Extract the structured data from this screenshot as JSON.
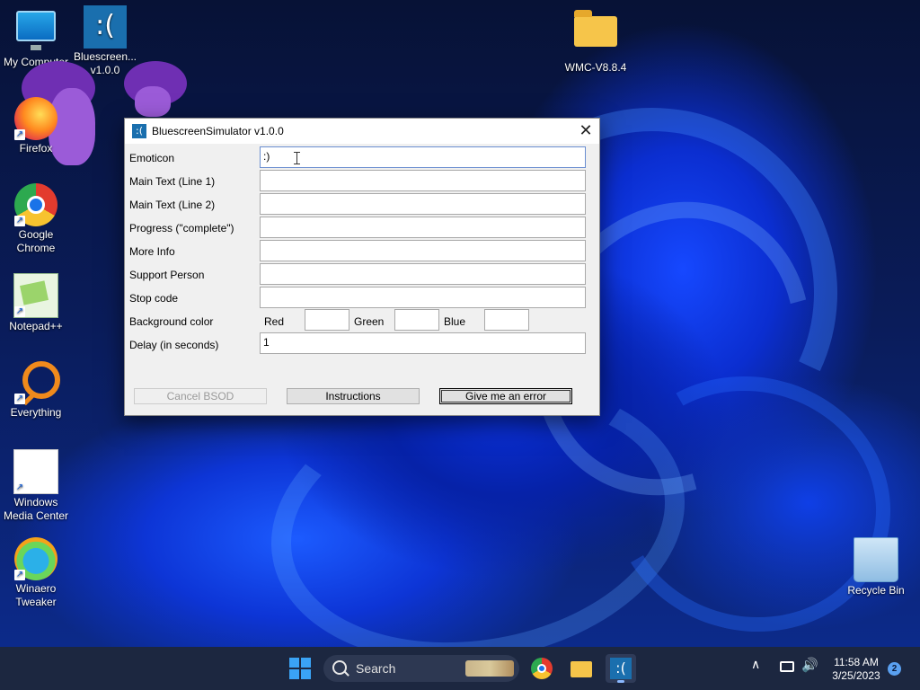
{
  "desktop": {
    "icons": [
      {
        "label": "My Computer"
      },
      {
        "label": "Bluescreen...\nv1.0.0",
        "line1": "Bluescreen...",
        "line2": "v1.0.0",
        "glyph": ":("
      },
      {
        "label": "WMC-V8.8.4"
      },
      {
        "label": "Firefox"
      },
      {
        "label_line1": "Google",
        "label_line2": "Chrome"
      },
      {
        "label": "Notepad++"
      },
      {
        "label": "Everything"
      },
      {
        "label_line1": "Windows",
        "label_line2": "Media Center"
      },
      {
        "label_line1": "Winaero",
        "label_line2": "Tweaker"
      },
      {
        "label": "Recycle Bin"
      }
    ],
    "shortcut_glyph": "↗"
  },
  "window": {
    "title": "BluescreenSimulator v1.0.0",
    "icon_glyph": ":(",
    "close_glyph": "✕",
    "fields": {
      "emoticon": {
        "label": "Emoticon",
        "value": ":)"
      },
      "main_text_1": {
        "label": "Main Text (Line 1)",
        "value": ""
      },
      "main_text_2": {
        "label": "Main Text (Line 2)",
        "value": ""
      },
      "progress": {
        "label": "Progress (\"complete\")",
        "value": ""
      },
      "more_info": {
        "label": "More Info",
        "value": ""
      },
      "support_person": {
        "label": "Support Person",
        "value": ""
      },
      "stop_code": {
        "label": "Stop code",
        "value": ""
      },
      "background_color": {
        "label": "Background color",
        "red_label": "Red",
        "green_label": "Green",
        "blue_label": "Blue",
        "red": "",
        "green": "",
        "blue": ""
      },
      "delay": {
        "label": "Delay (in seconds)",
        "value": "1"
      }
    },
    "buttons": {
      "cancel": "Cancel BSOD",
      "instructions": "Instructions",
      "error": "Give me an error"
    }
  },
  "taskbar": {
    "search_label": "Search",
    "chevron_glyph": "∧",
    "volume_glyph": "🔊",
    "time": "11:58 AM",
    "date": "3/25/2023",
    "notification_count": "2",
    "bsod_glyph": ":("
  }
}
